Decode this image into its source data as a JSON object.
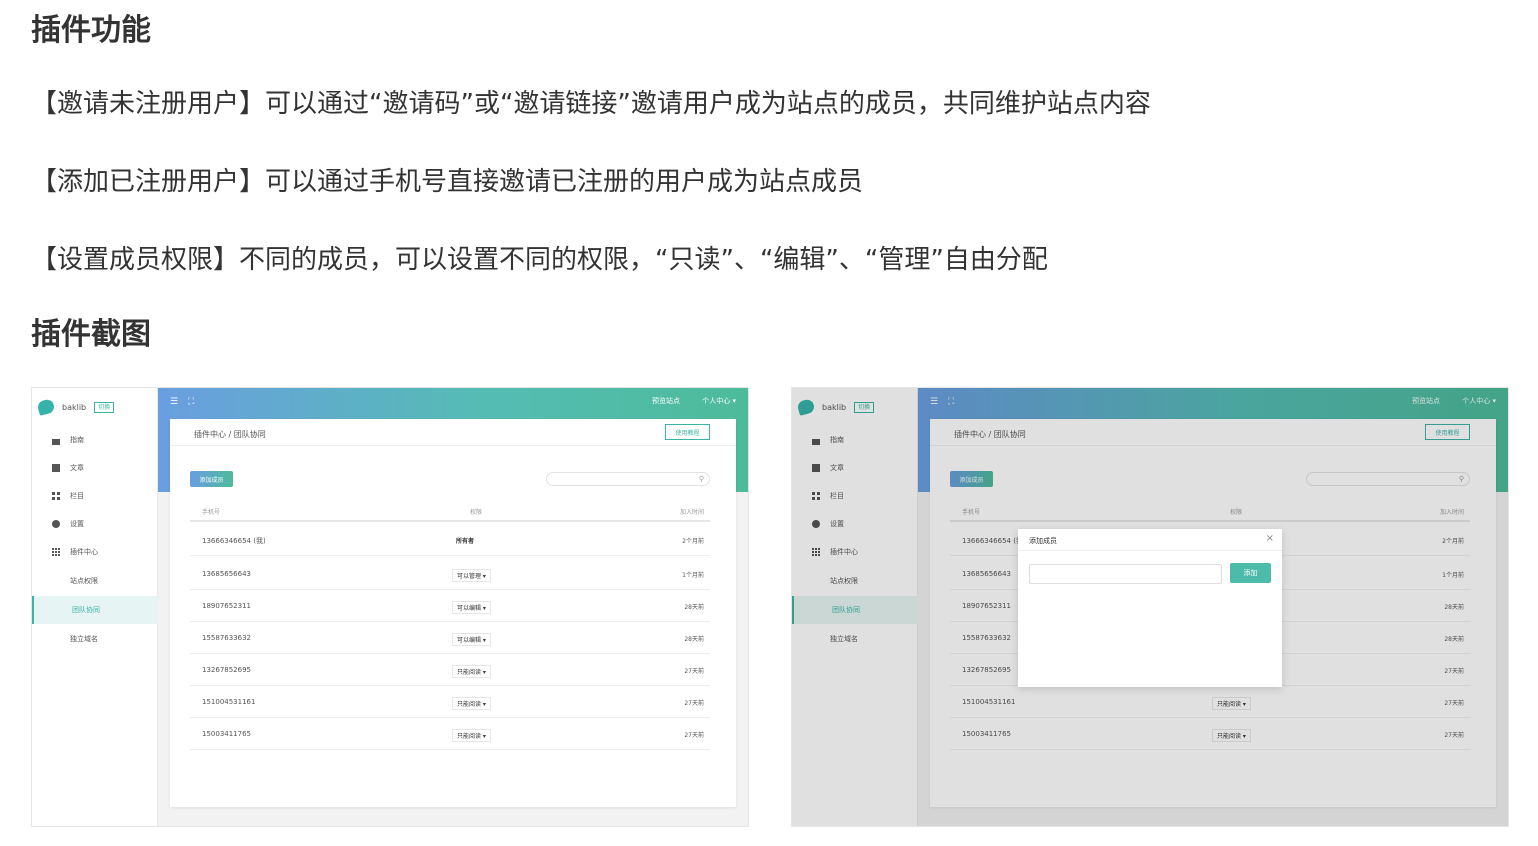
{
  "headings": {
    "features": "插件功能",
    "screenshots": "插件截图"
  },
  "features": [
    "【邀请未注册用户】可以通过“邀请码”或“邀请链接”邀请用户成为站点的成员，共同维护站点内容",
    "【添加已注册用户】可以通过手机号直接邀请已注册的用户成为站点成员",
    "【设置成员权限】不同的成员，可以设置不同的权限，“只读”、“编辑”、“管理”自由分配"
  ],
  "app": {
    "brand": "baklib",
    "switch_label": "切换",
    "menu": [
      "指南",
      "文章",
      "栏目",
      "设置",
      "插件中心"
    ],
    "submenu": [
      "站点权限",
      "团队协同",
      "独立域名"
    ],
    "topbar": {
      "preview": "预览站点",
      "profile": "个人中心 ▾"
    },
    "breadcrumb": "插件中心 / 团队协同",
    "tutorial": "使用教程",
    "add_member": "添加成员",
    "columns": [
      "手机号",
      "权限",
      "加入时间"
    ],
    "rows": [
      {
        "phone": "13666346654 (我)",
        "perm": "所有者",
        "time": "2个月前"
      },
      {
        "phone": "13685656643",
        "perm": "可以管理 ▾",
        "time": "1个月前"
      },
      {
        "phone": "18907652311",
        "perm": "可以编辑 ▾",
        "time": "28天前"
      },
      {
        "phone": "15587633632",
        "perm": "可以编辑 ▾",
        "time": "28天前"
      },
      {
        "phone": "13267852695",
        "perm": "只能阅读 ▾",
        "time": "27天前"
      },
      {
        "phone": "151004531161",
        "perm": "只能阅读 ▾",
        "time": "27天前"
      },
      {
        "phone": "15003411765",
        "perm": "只能阅读 ▾",
        "time": "27天前"
      }
    ],
    "modal": {
      "title": "添加成员",
      "close": "×",
      "add": "添加"
    }
  }
}
